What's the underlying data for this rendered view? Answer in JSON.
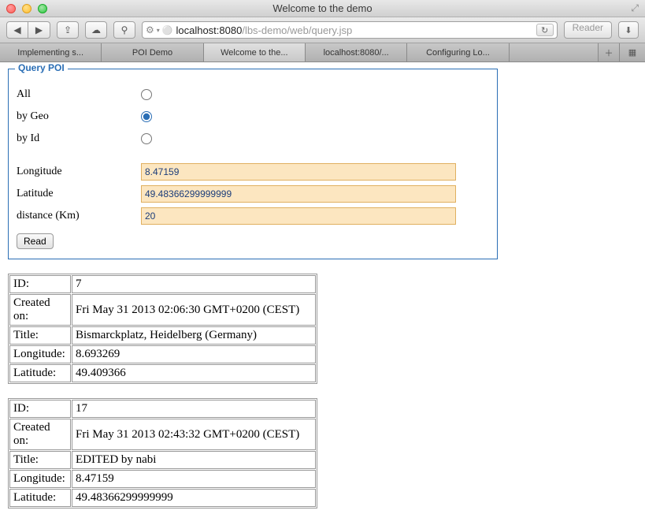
{
  "window": {
    "title": "Welcome to the demo"
  },
  "urlbar": {
    "host": "localhost:8080",
    "path": "/lbs-demo/web/query.jsp",
    "reader_label": "Reader"
  },
  "tabs": [
    {
      "label": "Implementing s..."
    },
    {
      "label": "POI Demo"
    },
    {
      "label": "Welcome to the..."
    },
    {
      "label": "localhost:8080/..."
    },
    {
      "label": "Configuring Lo..."
    }
  ],
  "form": {
    "legend": "Query POI",
    "radios": {
      "all": "All",
      "by_geo": "by Geo",
      "by_id": "by Id"
    },
    "fields": {
      "longitude_label": "Longitude",
      "longitude_value": "8.47159",
      "latitude_label": "Latitude",
      "latitude_value": "49.48366299999999",
      "distance_label": "distance (Km)",
      "distance_value": "20"
    },
    "read_button": "Read"
  },
  "result_labels": {
    "id": "ID:",
    "created": "Created on:",
    "title": "Title:",
    "longitude": "Longitude:",
    "latitude": "Latitude:"
  },
  "results": [
    {
      "id": "7",
      "created": "Fri May 31 2013 02:06:30 GMT+0200 (CEST)",
      "title": "Bismarckplatz, Heidelberg (Germany)",
      "longitude": "8.693269",
      "latitude": "49.409366"
    },
    {
      "id": "17",
      "created": "Fri May 31 2013 02:43:32 GMT+0200 (CEST)",
      "title": "EDITED by nabi",
      "longitude": "8.47159",
      "latitude": "49.48366299999999"
    }
  ]
}
